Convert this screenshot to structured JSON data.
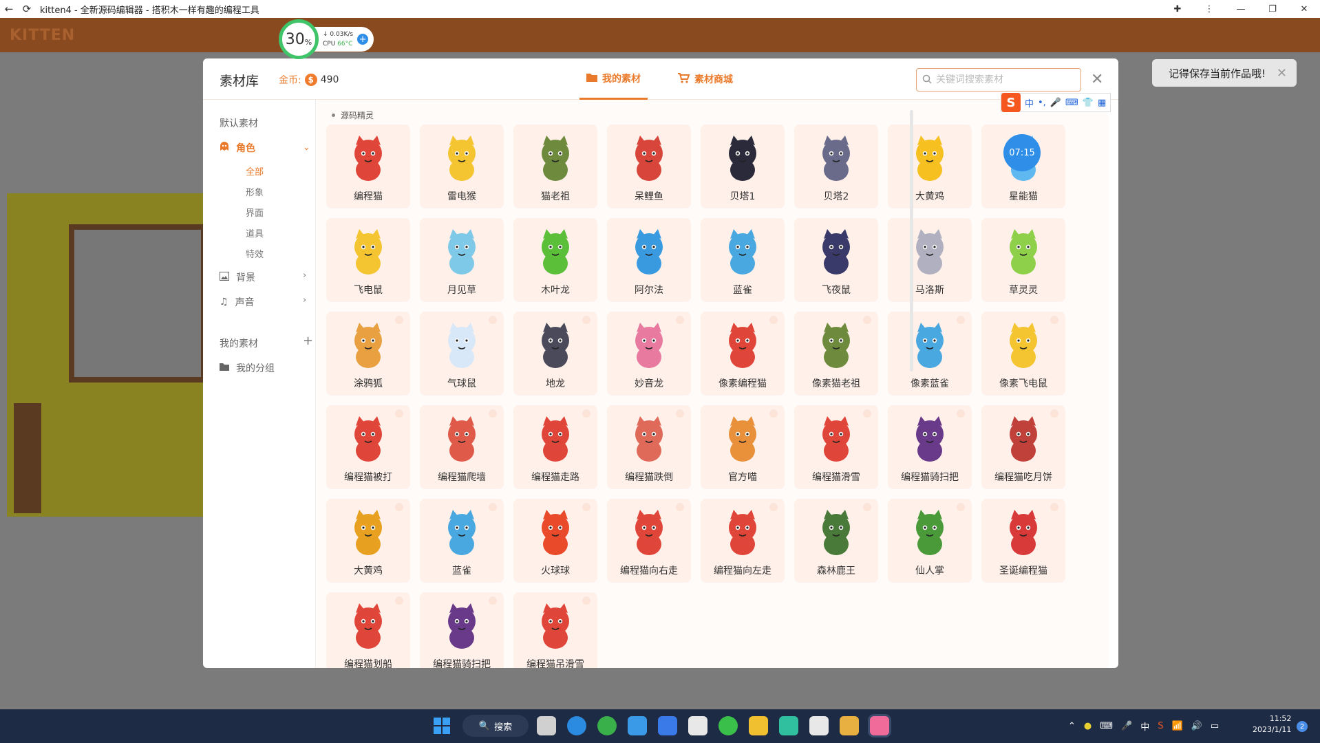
{
  "window": {
    "title": "kitten4 - 全新源码编辑器 - 搭积木一样有趣的编程工具"
  },
  "app": {
    "logo": "KITTEN"
  },
  "cpu_widget": {
    "percent": "30",
    "percent_unit": "%",
    "net_speed": "0.03K/s",
    "cpu_label": "CPU",
    "cpu_temp": "66°C"
  },
  "toast": {
    "message": "记得保存当前作品哦!"
  },
  "modal": {
    "title": "素材库",
    "coins_label": "金币:",
    "coins_amount": "490",
    "tabs": [
      {
        "label": "我的素材",
        "active": true
      },
      {
        "label": "素材商城",
        "active": false
      }
    ],
    "search_placeholder": "关键词搜索素材"
  },
  "ime": {
    "lang": "中"
  },
  "sidebar": {
    "default_heading": "默认素材",
    "categories": [
      {
        "label": "角色",
        "active": true
      },
      {
        "label": "背景"
      },
      {
        "label": "声音"
      }
    ],
    "sub_items": [
      "全部",
      "形象",
      "界面",
      "道具",
      "特效"
    ],
    "my_heading": "我的素材",
    "my_group": "我的分组"
  },
  "content": {
    "section_label": "源码精灵",
    "overlay_time": "07:15",
    "items": [
      {
        "name": "编程猫",
        "color": "#e0453a"
      },
      {
        "name": "雷电猴",
        "color": "#f5c531"
      },
      {
        "name": "猫老祖",
        "color": "#6e8b3d"
      },
      {
        "name": "呆鲤鱼",
        "color": "#d8463b"
      },
      {
        "name": "贝塔1",
        "color": "#2a2a3a"
      },
      {
        "name": "贝塔2",
        "color": "#6a6a8a"
      },
      {
        "name": "大黄鸡",
        "color": "#f5c020"
      },
      {
        "name": "星能猫",
        "color": "#5fb8f0"
      },
      {
        "name": "飞电鼠",
        "color": "#f5c531"
      },
      {
        "name": "月见草",
        "color": "#7ec8e8"
      },
      {
        "name": "木叶龙",
        "color": "#5cbf3a"
      },
      {
        "name": "阿尔法",
        "color": "#3a9ae0"
      },
      {
        "name": "蓝雀",
        "color": "#4aa8e0"
      },
      {
        "name": "飞夜鼠",
        "color": "#3a3a6a"
      },
      {
        "name": "马洛斯",
        "color": "#b0b0c0"
      },
      {
        "name": "草灵灵",
        "color": "#8fd04a"
      },
      {
        "name": "涂鸦狐",
        "color": "#e8a040"
      },
      {
        "name": "气球鼠",
        "color": "#d8e8f8"
      },
      {
        "name": "地龙",
        "color": "#4a4a5a"
      },
      {
        "name": "妙音龙",
        "color": "#e87aa0"
      },
      {
        "name": "像素编程猫",
        "color": "#e0453a"
      },
      {
        "name": "像素猫老祖",
        "color": "#6e8b3d"
      },
      {
        "name": "像素蓝雀",
        "color": "#4aa8e0"
      },
      {
        "name": "像素飞电鼠",
        "color": "#f5c531"
      },
      {
        "name": "编程猫被打",
        "color": "#e0453a"
      },
      {
        "name": "编程猫爬墙",
        "color": "#e05a4a"
      },
      {
        "name": "编程猫走路",
        "color": "#e0453a"
      },
      {
        "name": "编程猫跌倒",
        "color": "#e06a5a"
      },
      {
        "name": "官方喵",
        "color": "#e8903a"
      },
      {
        "name": "编程猫滑雪",
        "color": "#e0453a"
      },
      {
        "name": "编程猫骑扫把",
        "color": "#6a3a8a"
      },
      {
        "name": "编程猫吃月饼",
        "color": "#c0403a"
      },
      {
        "name": "大黄鸡",
        "color": "#e8a020"
      },
      {
        "name": "蓝雀",
        "color": "#4aa8e0"
      },
      {
        "name": "火球球",
        "color": "#e84a2a"
      },
      {
        "name": "编程猫向右走",
        "color": "#e0453a"
      },
      {
        "name": "编程猫向左走",
        "color": "#e0453a"
      },
      {
        "name": "森林鹿王",
        "color": "#4a7a3a"
      },
      {
        "name": "仙人掌",
        "color": "#4a9a3a"
      },
      {
        "name": "圣诞编程猫",
        "color": "#d83a3a"
      },
      {
        "name": "编程猫划船",
        "color": "#e0453a"
      },
      {
        "name": "编程猫骑扫把",
        "color": "#6a3a8a"
      },
      {
        "name": "编程猫吊滑雪",
        "color": "#e0453a"
      }
    ]
  },
  "taskbar": {
    "search_label": "搜索",
    "ime_lang": "中",
    "time": "11:52",
    "date": "2023/1/11",
    "notification_count": "2"
  }
}
